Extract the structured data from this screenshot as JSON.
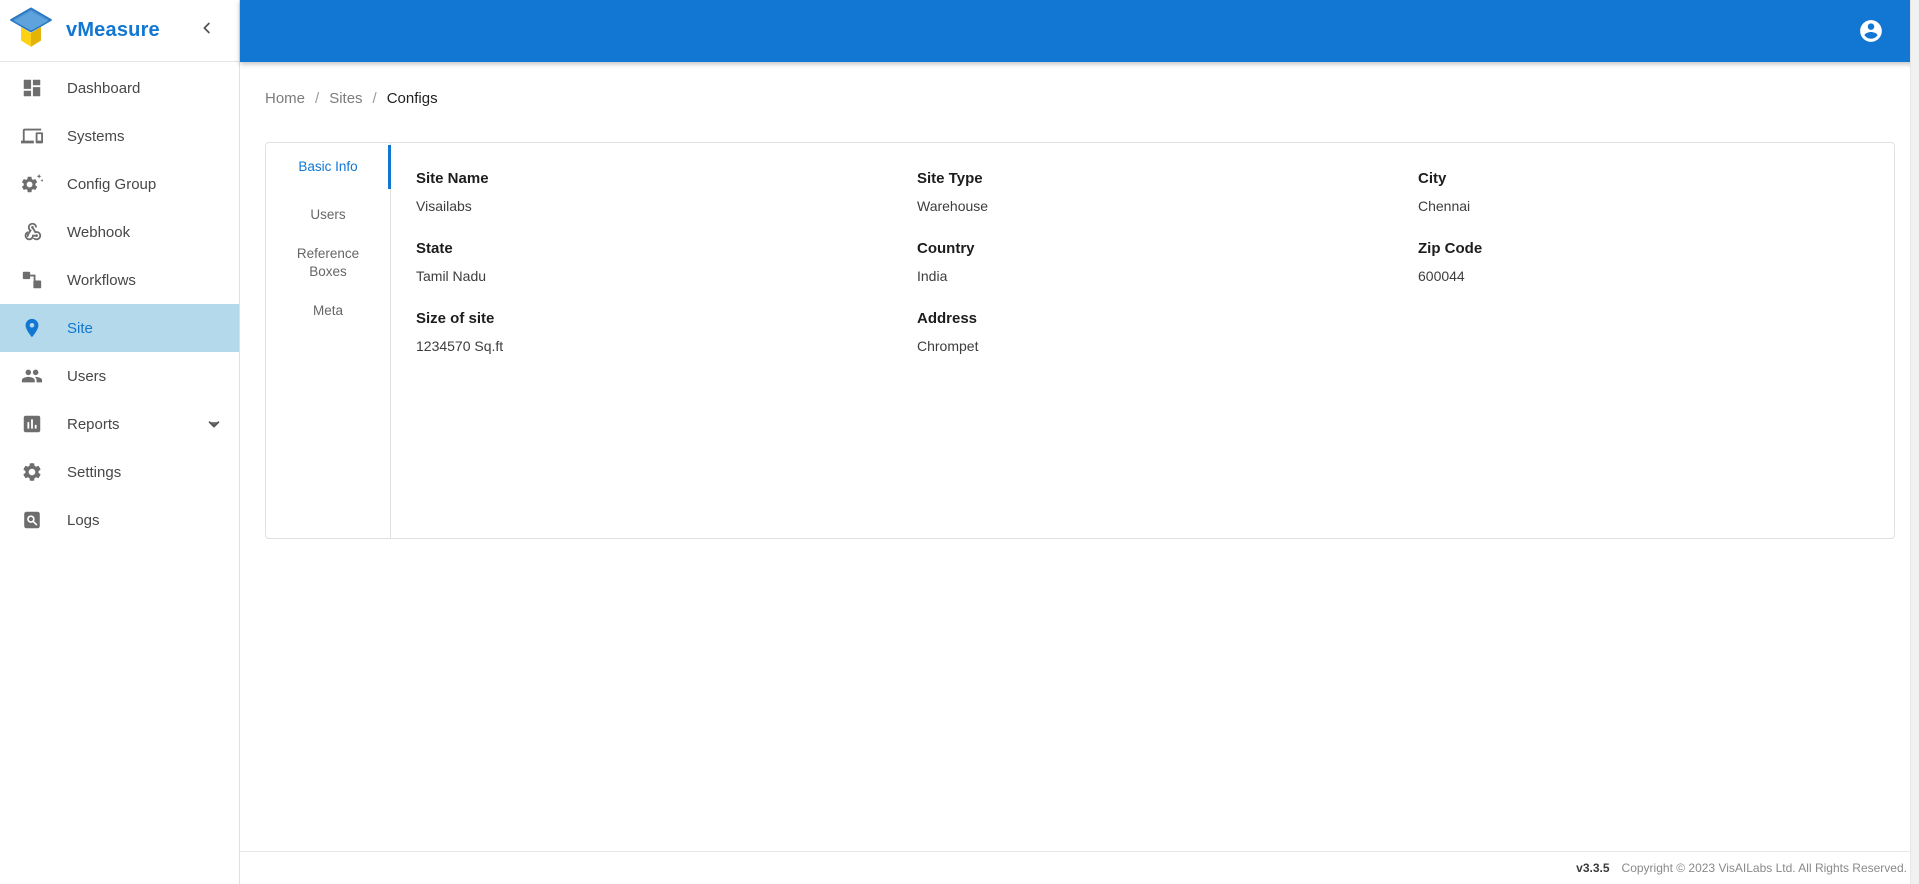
{
  "brand": {
    "name": "vMeasure",
    "logo_icon": "vmeasure-cube-logo",
    "collapse_icon": "chevron-left-icon"
  },
  "topbar": {
    "account_icon": "account-circle-icon",
    "background_color": "#1277d2"
  },
  "sidebar": {
    "active_item": "Site",
    "active_bg_color": "#b3d9ea",
    "items": [
      {
        "label": "Dashboard",
        "icon": "dashboard-icon"
      },
      {
        "label": "Systems",
        "icon": "systems-icon"
      },
      {
        "label": "Config Group",
        "icon": "config-group-icon"
      },
      {
        "label": "Webhook",
        "icon": "webhook-icon"
      },
      {
        "label": "Workflows",
        "icon": "workflows-icon"
      },
      {
        "label": "Site",
        "icon": "location-pin-icon",
        "active": true
      },
      {
        "label": "Users",
        "icon": "users-icon"
      },
      {
        "label": "Reports",
        "icon": "reports-icon",
        "expand_icon": "chevron-down-icon"
      },
      {
        "label": "Settings",
        "icon": "settings-gear-icon"
      },
      {
        "label": "Logs",
        "icon": "logs-search-icon"
      }
    ]
  },
  "breadcrumb": {
    "separator": "/",
    "items": [
      {
        "label": "Home"
      },
      {
        "label": "Sites"
      },
      {
        "label": "Configs",
        "current": true
      }
    ]
  },
  "tabs": [
    {
      "label": "Basic Info",
      "active": true
    },
    {
      "label": "Users"
    },
    {
      "label": "Reference Boxes"
    },
    {
      "label": "Meta"
    }
  ],
  "site_details": {
    "fields": [
      {
        "label": "Site Name",
        "value": "Visailabs"
      },
      {
        "label": "Site Type",
        "value": "Warehouse"
      },
      {
        "label": "City",
        "value": "Chennai"
      },
      {
        "label": "State",
        "value": "Tamil Nadu"
      },
      {
        "label": "Country",
        "value": "India"
      },
      {
        "label": "Zip Code",
        "value": "600044"
      },
      {
        "label": "Size of site",
        "value": "1234570 Sq.ft"
      },
      {
        "label": "Address",
        "value": "Chrompet"
      }
    ]
  },
  "footer": {
    "version": "v3.3.5",
    "copyright": "Copyright © 2023 VisAILabs Ltd. All Rights Reserved."
  },
  "colors": {
    "brand_blue": "#1277d2",
    "active_item_bg": "#b3d9ea",
    "logo_yellow": "#fcd116",
    "logo_blue": "#4e97d4"
  }
}
